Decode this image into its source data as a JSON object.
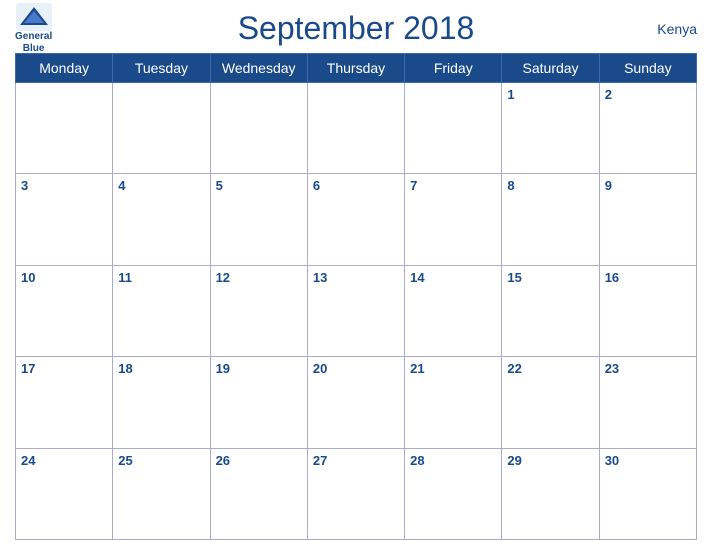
{
  "header": {
    "title": "September 2018",
    "country": "Kenya",
    "logo": {
      "line1": "General",
      "line2": "Blue"
    }
  },
  "weekdays": [
    "Monday",
    "Tuesday",
    "Wednesday",
    "Thursday",
    "Friday",
    "Saturday",
    "Sunday"
  ],
  "weeks": [
    [
      {
        "day": "",
        "empty": true
      },
      {
        "day": "",
        "empty": true
      },
      {
        "day": "",
        "empty": true
      },
      {
        "day": "",
        "empty": true
      },
      {
        "day": "",
        "empty": true
      },
      {
        "day": "1"
      },
      {
        "day": "2"
      }
    ],
    [
      {
        "day": "3"
      },
      {
        "day": "4"
      },
      {
        "day": "5"
      },
      {
        "day": "6"
      },
      {
        "day": "7"
      },
      {
        "day": "8"
      },
      {
        "day": "9"
      }
    ],
    [
      {
        "day": "10"
      },
      {
        "day": "11"
      },
      {
        "day": "12"
      },
      {
        "day": "13"
      },
      {
        "day": "14"
      },
      {
        "day": "15"
      },
      {
        "day": "16"
      }
    ],
    [
      {
        "day": "17"
      },
      {
        "day": "18"
      },
      {
        "day": "19"
      },
      {
        "day": "20"
      },
      {
        "day": "21"
      },
      {
        "day": "22"
      },
      {
        "day": "23"
      }
    ],
    [
      {
        "day": "24"
      },
      {
        "day": "25"
      },
      {
        "day": "26"
      },
      {
        "day": "27"
      },
      {
        "day": "28"
      },
      {
        "day": "29"
      },
      {
        "day": "30"
      }
    ]
  ]
}
